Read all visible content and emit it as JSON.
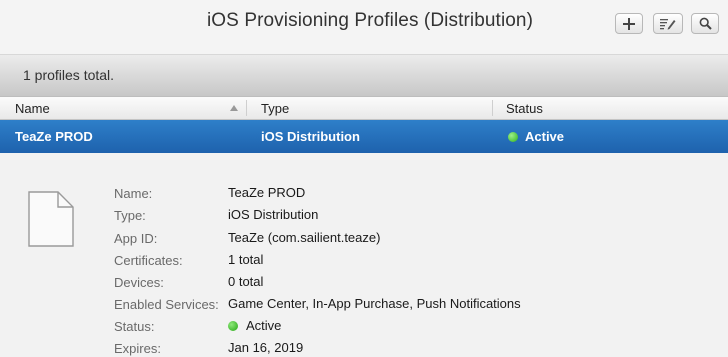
{
  "header": {
    "title": "iOS Provisioning Profiles (Distribution)",
    "buttons": {
      "add_icon": "plus-icon",
      "edit_icon": "edit-icon",
      "search_icon": "search-icon"
    }
  },
  "summary": {
    "text": "1 profiles total."
  },
  "table": {
    "columns": {
      "name": "Name",
      "type": "Type",
      "status": "Status"
    },
    "sort": "Name ascending",
    "rows": [
      {
        "name": "TeaZe PROD",
        "type": "iOS Distribution",
        "status": "Active",
        "selected": true
      }
    ]
  },
  "detail": {
    "icon": "document-icon",
    "fields": {
      "name": {
        "label": "Name:",
        "value": "TeaZe PROD"
      },
      "type": {
        "label": "Type:",
        "value": "iOS Distribution"
      },
      "app_id": {
        "label": "App ID:",
        "value": "TeaZe (com.sailient.teaze)"
      },
      "certificates": {
        "label": "Certificates:",
        "value": "1 total"
      },
      "devices": {
        "label": "Devices:",
        "value": "0 total"
      },
      "services": {
        "label": "Enabled Services:",
        "value": "Game Center, In-App Purchase, Push Notifications"
      },
      "status": {
        "label": "Status:",
        "value": "Active"
      },
      "expires": {
        "label": "Expires:",
        "value": "Jan 16, 2019"
      }
    }
  },
  "colors": {
    "selection": "#1e6bb8",
    "status_active": "#2fb31a"
  }
}
